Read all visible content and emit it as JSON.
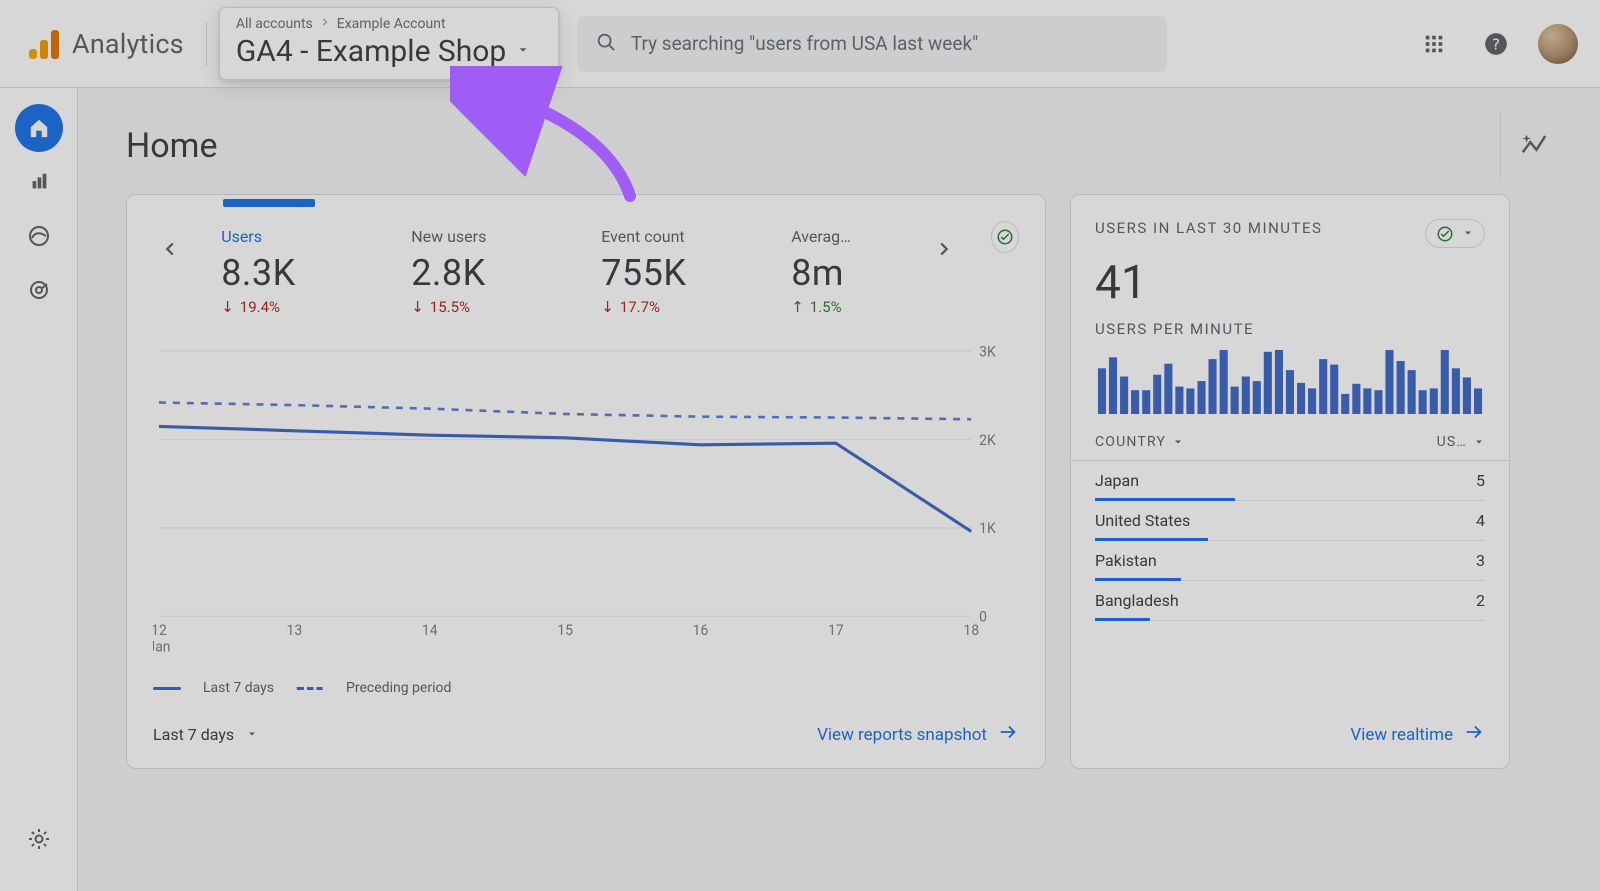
{
  "brand": {
    "title": "Analytics"
  },
  "breadcrumb": {
    "root": "All accounts",
    "account": "Example Account"
  },
  "picker": {
    "title": "GA4 - Example Shop"
  },
  "search": {
    "placeholder": "Try searching \"users from USA last week\""
  },
  "page": {
    "title": "Home"
  },
  "nav": {
    "items": [
      "home",
      "reports",
      "explore",
      "advertising"
    ],
    "settings": "settings"
  },
  "cardA": {
    "metrics": [
      {
        "label": "Users",
        "value": "8.3K",
        "delta": "19.4%",
        "dir": "down",
        "active": true
      },
      {
        "label": "New users",
        "value": "2.8K",
        "delta": "15.5%",
        "dir": "down"
      },
      {
        "label": "Event count",
        "value": "755K",
        "delta": "17.7%",
        "dir": "down"
      },
      {
        "label": "Averag…",
        "value": "8m",
        "delta": "1.5%",
        "dir": "up"
      }
    ],
    "range_label": "Last 7 days",
    "legend": {
      "current": "Last 7 days",
      "previous": "Preceding period"
    },
    "link": "View reports snapshot"
  },
  "cardB": {
    "title": "USERS IN LAST 30 MINUTES",
    "big": "41",
    "sub": "USERS PER MINUTE",
    "headers": {
      "left": "COUNTRY",
      "right": "US…"
    },
    "rows": [
      {
        "name": "Japan",
        "value": "5",
        "pct": 36
      },
      {
        "name": "United States",
        "value": "4",
        "pct": 29
      },
      {
        "name": "Pakistan",
        "value": "3",
        "pct": 22
      },
      {
        "name": "Bangladesh",
        "value": "2",
        "pct": 14
      }
    ],
    "link": "View realtime"
  },
  "chart_data": {
    "type": "line",
    "title": "",
    "xlabel": "",
    "ylabel": "",
    "ylim": [
      0,
      3000
    ],
    "categories": [
      "12 Jan",
      "13",
      "14",
      "15",
      "16",
      "17",
      "18"
    ],
    "y_ticks": [
      0,
      1000,
      2000,
      3000
    ],
    "y_tick_labels": [
      "0",
      "1K",
      "2K",
      "3K"
    ],
    "series": [
      {
        "name": "Last 7 days",
        "values": [
          2150,
          2100,
          2050,
          2020,
          1940,
          1960,
          960
        ]
      },
      {
        "name": "Preceding period",
        "values": [
          2420,
          2390,
          2350,
          2290,
          2260,
          2250,
          2230
        ]
      }
    ],
    "realtime_per_minute_bars": [
      50,
      62,
      41,
      26,
      26,
      43,
      55,
      30,
      28,
      36,
      60,
      70,
      30,
      41,
      36,
      68,
      70,
      48,
      34,
      28,
      60,
      54,
      22,
      33,
      28,
      26,
      70,
      58,
      48,
      26,
      28,
      70,
      50,
      40,
      28
    ]
  }
}
